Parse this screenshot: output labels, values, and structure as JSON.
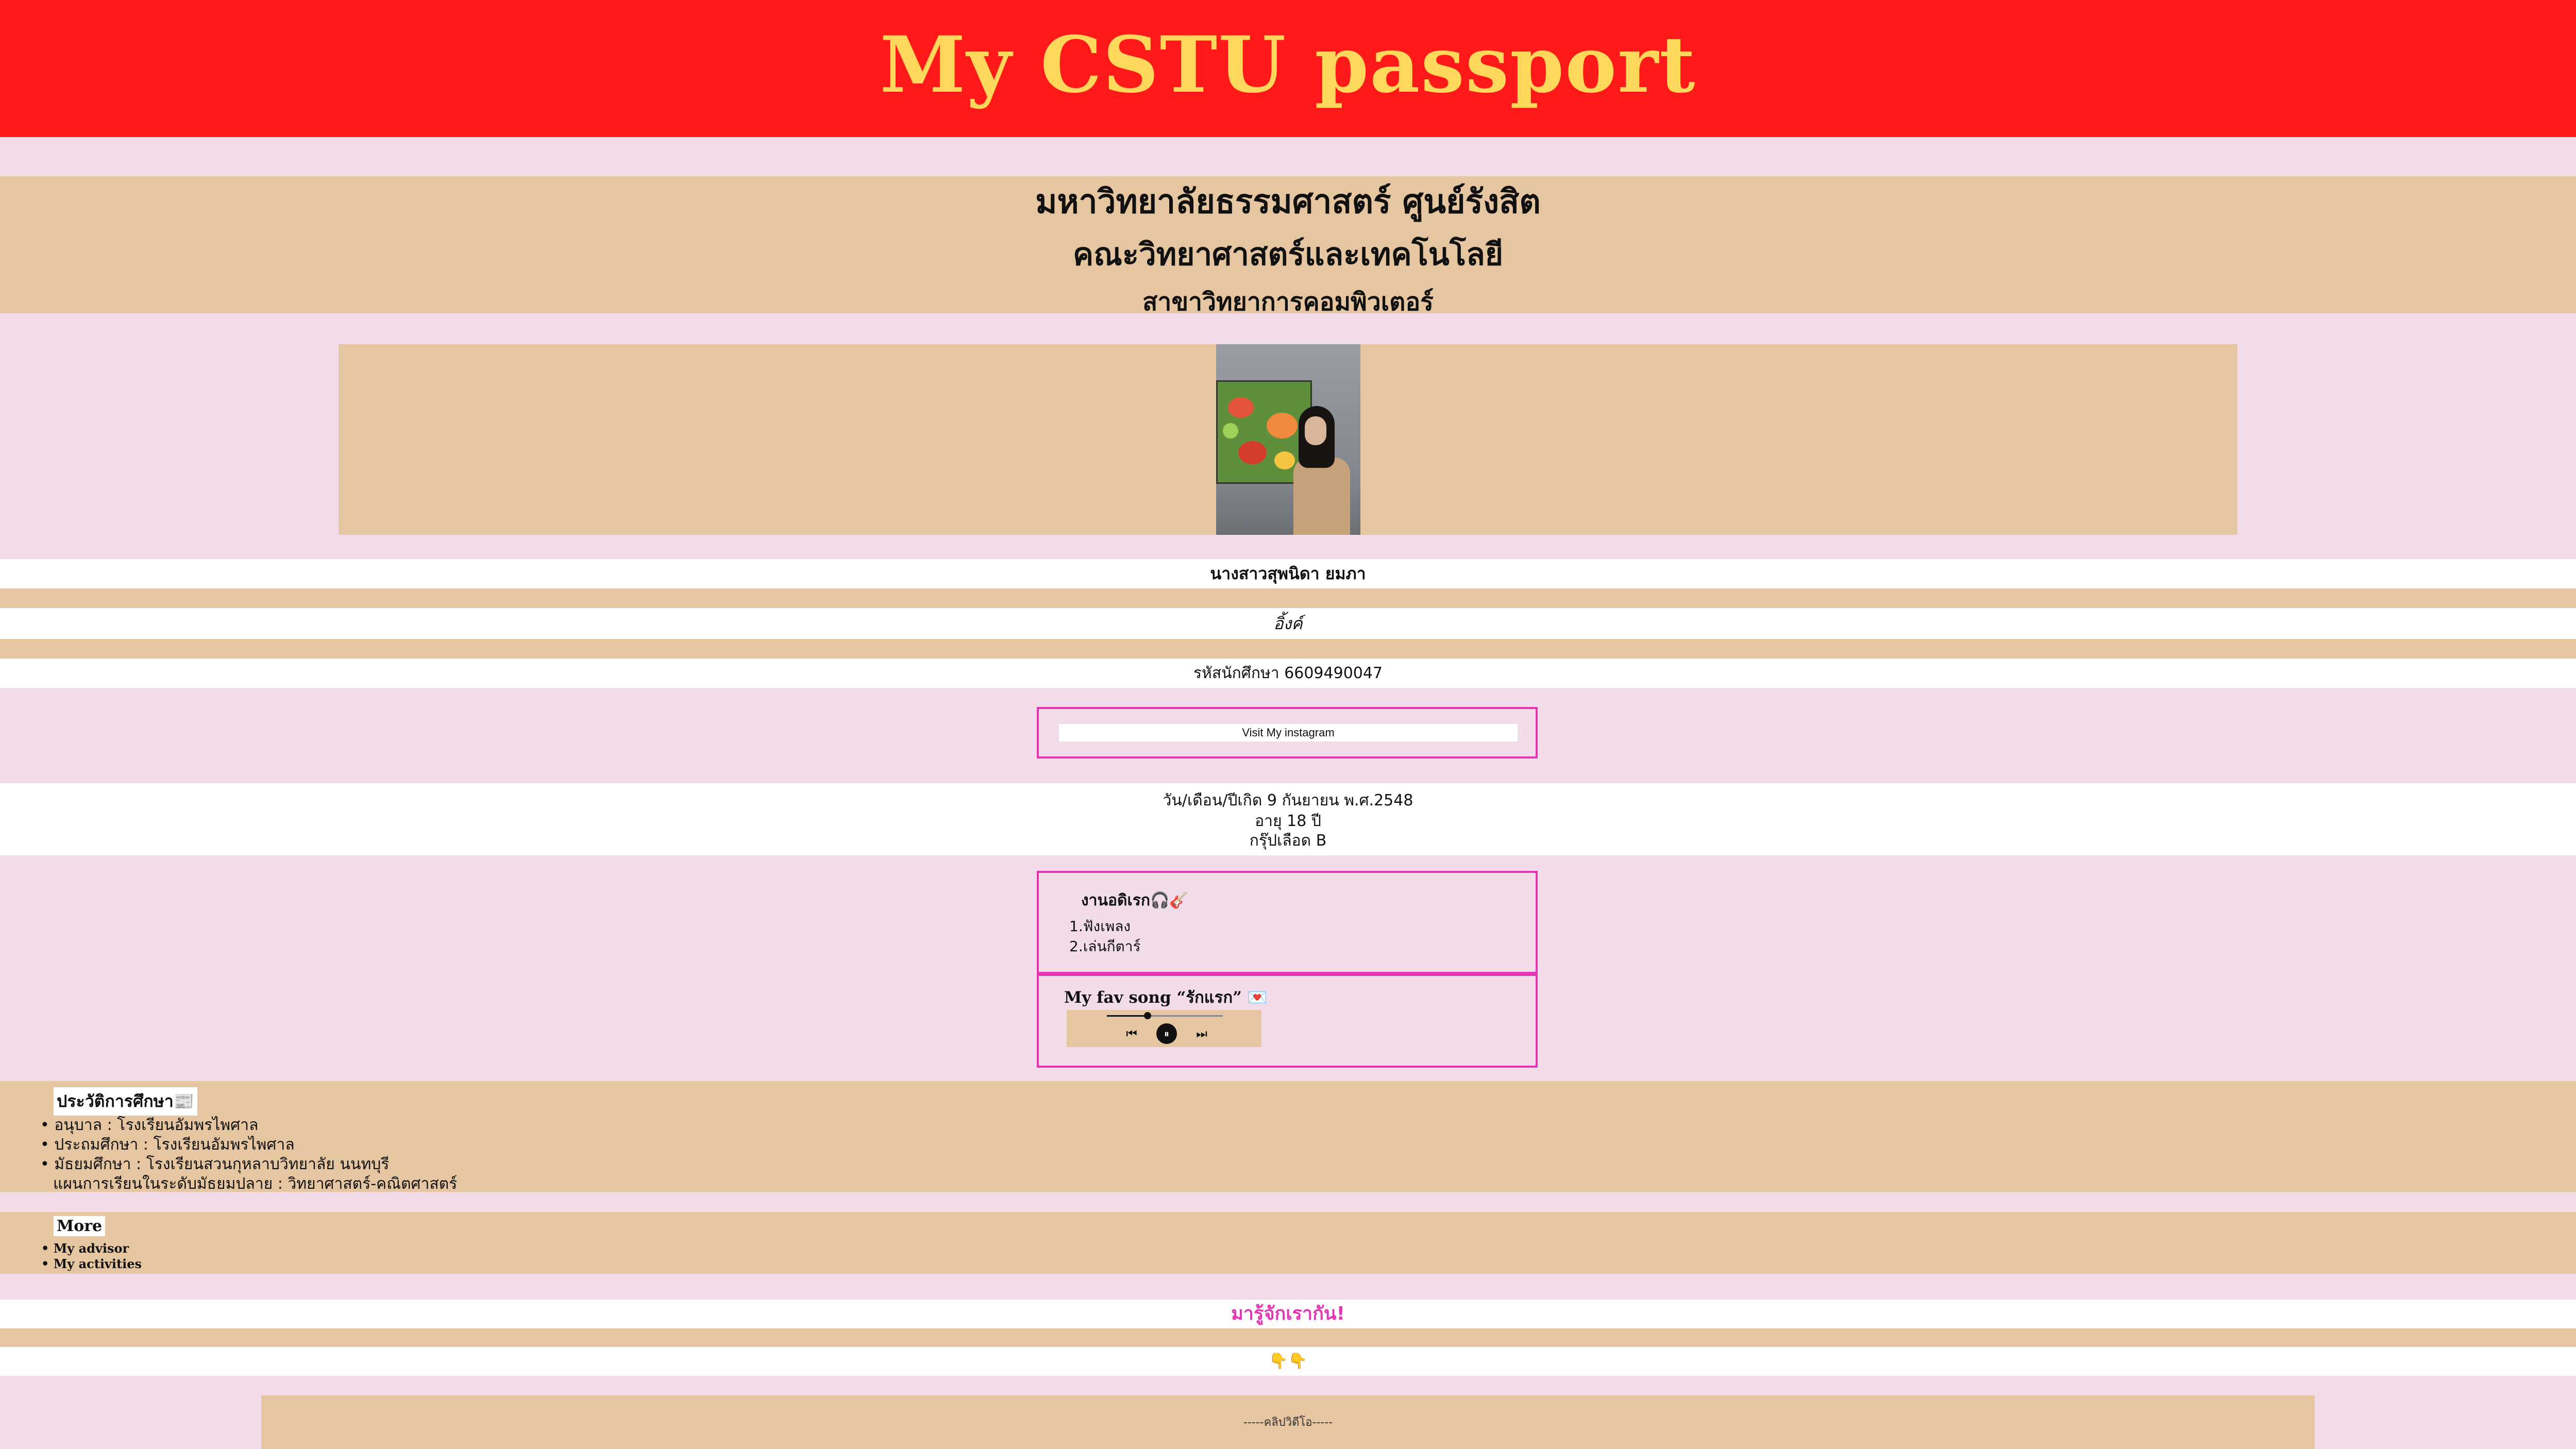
{
  "header": {
    "title": "My CSTU passport"
  },
  "university": {
    "line1": "มหาวิทยาลัยธรรมศาสตร์ ศูนย์รังสิต",
    "line2": "คณะวิทยาศาสตร์และเทคโนโลยี",
    "line3": "สาขาวิทยาการคอมพิวเตอร์"
  },
  "profile": {
    "name": "นางสาวสุพนิดา ยมภา",
    "nickname": "อิ้งค์",
    "student_id": "รหัสนักศึกษา 6609490047",
    "instagram_button": "Visit My instagram"
  },
  "info": {
    "birthday": "วัน/เดือน/ปีเกิด 9 กันยายน พ.ศ.2548",
    "age": "อายุ 18 ปี",
    "blood": "กรุ๊ปเลือด B"
  },
  "hobbies": {
    "title": "งานอดิเรก🎧🎸",
    "items": [
      "1.ฟังเพลง",
      "2.เล่นกีตาร์"
    ]
  },
  "song": {
    "title": "My fav song “รักแรก” 💌",
    "progress": 0.35,
    "prev_icon": "previous-track-icon",
    "pause_icon": "pause-icon",
    "next_icon": "next-track-icon"
  },
  "education": {
    "title": "ประวัติการศึกษา📰",
    "items": [
      "• อนุบาล : โรงเรียนอัมพรไพศาล",
      "• ประถมศึกษา : โรงเรียนอัมพรไพศาล",
      "• มัธยมศึกษา : โรงเรียนสวนกุหลาบวิทยาลัย นนทบุรี",
      "แผนการเรียนในระดับมัธยมปลาย : วิทยาศาสตร์-คณิตศาสตร์"
    ]
  },
  "more": {
    "title": "More",
    "links": [
      "• My advisor",
      "• My activities"
    ]
  },
  "meet": {
    "text": "มารู้จักเรากัน!",
    "emoji": "👇👇"
  },
  "video": {
    "label": "-----คลิปวิดีโอ-----"
  },
  "colors": {
    "header_bg": "#ff1a1a",
    "header_text": "#ffd75a",
    "page_bg": "#f3dcea",
    "band_tan": "#e5c6a0",
    "accent_pink": "#e436b4"
  }
}
